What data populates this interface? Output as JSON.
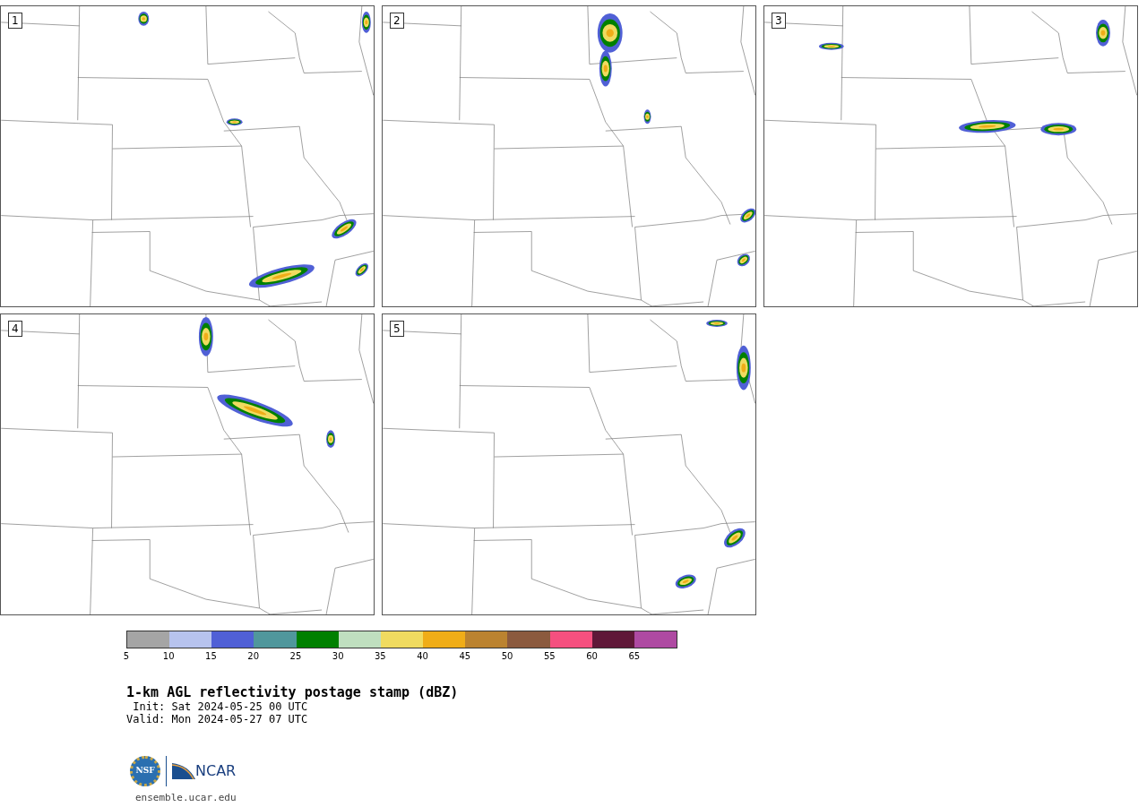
{
  "panels": [
    {
      "label": "1"
    },
    {
      "label": "2"
    },
    {
      "label": "3"
    },
    {
      "label": "4"
    },
    {
      "label": "5"
    }
  ],
  "colorbar": {
    "bins": [
      {
        "color": "#a5a5a5"
      },
      {
        "color": "#b7c3ee"
      },
      {
        "color": "#5060d6"
      },
      {
        "color": "#50979c"
      },
      {
        "color": "#008000"
      },
      {
        "color": "#bfdfbf"
      },
      {
        "color": "#f0db60"
      },
      {
        "color": "#f0ad18"
      },
      {
        "color": "#bb8330"
      },
      {
        "color": "#8b5a3e"
      },
      {
        "color": "#f5507f"
      },
      {
        "color": "#5f1838"
      },
      {
        "color": "#ae4aa2"
      }
    ],
    "ticks": [
      "5",
      "10",
      "15",
      "20",
      "25",
      "30",
      "35",
      "40",
      "45",
      "50",
      "55",
      "60",
      "65"
    ]
  },
  "title": "1-km AGL reflectivity postage stamp (dBZ)",
  "init": " Init: Sat 2024-05-25 00 UTC",
  "valid": "Valid: Mon 2024-05-27 07 UTC",
  "logos": {
    "nsf": "NSF",
    "ncar": "NCAR"
  },
  "url": "ensemble.ucar.edu"
}
